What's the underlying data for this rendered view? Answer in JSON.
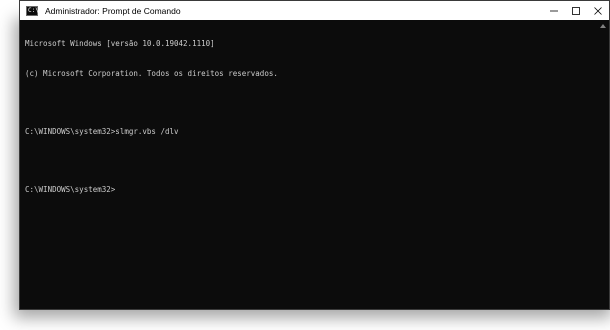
{
  "window": {
    "title": "Administrador: Prompt de Comando",
    "icon": "cmd-icon",
    "icon_glyph": "C:\\"
  },
  "console": {
    "lines": [
      "Microsoft Windows [versão 10.0.19042.1110]",
      "(c) Microsoft Corporation. Todos os direitos reservados.",
      "",
      "C:\\WINDOWS\\system32>slmgr.vbs /dlv",
      "",
      "C:\\WINDOWS\\system32>"
    ]
  },
  "controls": {
    "minimize": "minimize-icon",
    "maximize": "maximize-icon",
    "close": "close-icon"
  },
  "colors": {
    "console_bg": "#0c0c0c",
    "console_text": "#cccccc",
    "titlebar_bg": "#ffffff"
  }
}
